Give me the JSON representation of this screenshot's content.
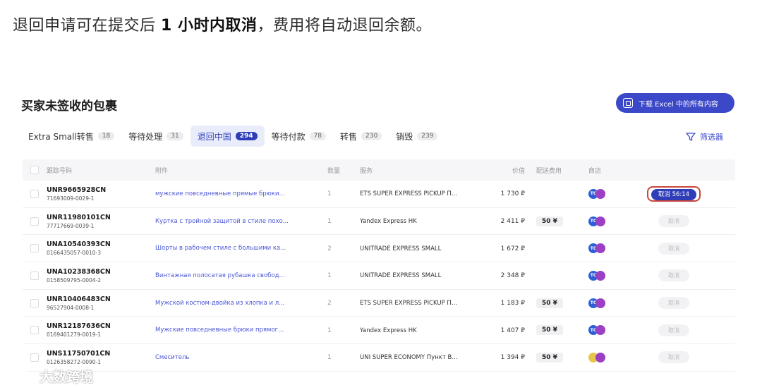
{
  "caption": {
    "pre": "退回申请可在提交后 ",
    "bold": "1 小时内取消",
    "post": "，费用将自动退回余额。"
  },
  "panel": {
    "title": "买家未签收的包裹",
    "download_label": "下载 Excel 中的所有内容",
    "filter_label": "筛选器"
  },
  "tabs": [
    {
      "label": "Extra Small转售",
      "count": "18"
    },
    {
      "label": "等待处理",
      "count": "31"
    },
    {
      "label": "退回中国",
      "count": "294"
    },
    {
      "label": "等待付款",
      "count": "78"
    },
    {
      "label": "转售",
      "count": "230"
    },
    {
      "label": "销毁",
      "count": "239"
    }
  ],
  "headers": {
    "track": "跟踪号码",
    "attachment": "附件",
    "qty": "数量",
    "service": "服务",
    "price": "价值",
    "fee": "配送费用",
    "shop": "商店"
  },
  "rows": [
    {
      "track": "UNR9665928CN",
      "sub": "71693009-0029-1",
      "att": "мужские повседневные прямые брюки...",
      "qty": "1",
      "svc": "ETS SUPER EXPRESS PICKUP П...",
      "price": "1 730 ₽",
      "fee": "",
      "shop": "TC",
      "action": "取消 56:14"
    },
    {
      "track": "UNR11980101CN",
      "sub": "77717669-0039-1",
      "att": "Куртка с тройной защитой в стиле похо...",
      "qty": "1",
      "svc": "Yandex Express HK",
      "price": "2 411 ₽",
      "fee": "50 ¥",
      "shop": "TC",
      "action": "取消"
    },
    {
      "track": "UNA10540393CN",
      "sub": "0166435057-0010-3",
      "att": "Шорты в рабочем стиле с большими ка...",
      "qty": "2",
      "svc": "UNITRADE EXPRESS SMALL",
      "price": "1 672 ₽",
      "fee": "",
      "shop": "TC",
      "action": "取消"
    },
    {
      "track": "UNA10238368CN",
      "sub": "0158509795-0004-2",
      "att": "Винтажная полосатая рубашка свобод...",
      "qty": "1",
      "svc": "UNITRADE EXPRESS SMALL",
      "price": "2 348 ₽",
      "fee": "",
      "shop": "TC",
      "action": "取消"
    },
    {
      "track": "UNR10406483CN",
      "sub": "96527904-0008-1",
      "att": "Мужской костюм-двойка из хлопка и л...",
      "qty": "2",
      "svc": "ETS SUPER EXPRESS PICKUP П...",
      "price": "1 183 ₽",
      "fee": "50 ¥",
      "shop": "TC",
      "action": "取消"
    },
    {
      "track": "UNR12187636CN",
      "sub": "0169401279-0019-1",
      "att": "Мужские повседневные брюки прямог...",
      "qty": "1",
      "svc": "Yandex Express HK",
      "price": "1 407 ₽",
      "fee": "50 ¥",
      "shop": "TC",
      "action": "取消"
    },
    {
      "track": "UNS11750701CN",
      "sub": "0126358272-0090-1",
      "att": "Смеситель",
      "qty": "1",
      "svc": "UNI SUPER ECONOMY Пункт В...",
      "price": "1 394 ₽",
      "fee": "50 ¥",
      "shop": "yellow",
      "action": "取消"
    }
  ],
  "watermark": {
    "text": "大数跨境"
  },
  "colors": {
    "accent": "#2f3eb8",
    "link": "#4a56d6",
    "highlight": "#c8463c"
  }
}
